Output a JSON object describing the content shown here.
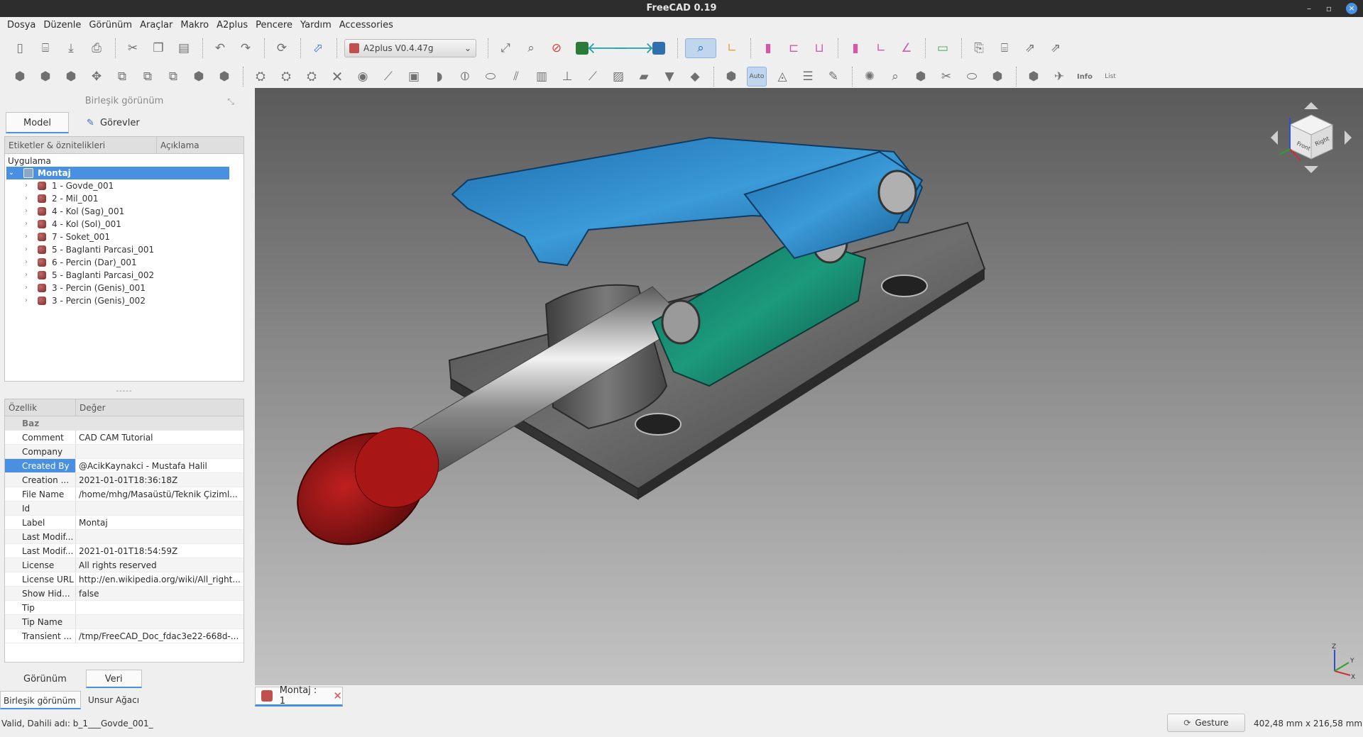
{
  "window": {
    "title": "FreeCAD 0.19"
  },
  "menu": [
    "Dosya",
    "Düzenle",
    "Görünüm",
    "Araçlar",
    "Makro",
    "A2plus",
    "Pencere",
    "Yardım",
    "Accessories"
  ],
  "toolbar": {
    "workbench": "A2plus V0.4.47g"
  },
  "combo_view": {
    "title": "Birleşik görünüm",
    "tabs": [
      "Model",
      "Görevler"
    ],
    "tree_headers": [
      "Etiketler & öznitelikleri",
      "Açıklama"
    ],
    "application": "Uygulama",
    "root": "Montaj",
    "items": [
      "1 - Govde_001",
      "2 - Mil_001",
      "4 - Kol (Sag)_001",
      "4 - Kol (Sol)_001",
      "7 - Soket_001",
      "5 - Baglanti Parcasi_001",
      "6 - Percin (Dar)_001",
      "5 - Baglanti Parcasi_002",
      "3 - Percin (Genis)_001",
      "3 - Percin (Genis)_002"
    ]
  },
  "properties": {
    "headers": [
      "Özellik",
      "Değer"
    ],
    "group": "Baz",
    "rows": [
      {
        "k": "Comment",
        "v": "CAD CAM Tutorial"
      },
      {
        "k": "Company",
        "v": ""
      },
      {
        "k": "Created By",
        "v": "@AcikKaynakci - Mustafa Halil"
      },
      {
        "k": "Creation ...",
        "v": "2021-01-01T18:36:18Z"
      },
      {
        "k": "File Name",
        "v": "/home/mhg/Masaüstü/Teknik Çiziml..."
      },
      {
        "k": "Id",
        "v": ""
      },
      {
        "k": "Label",
        "v": "Montaj"
      },
      {
        "k": "Last Modif...",
        "v": ""
      },
      {
        "k": "Last Modif...",
        "v": "2021-01-01T18:54:59Z"
      },
      {
        "k": "License",
        "v": "All rights reserved"
      },
      {
        "k": "License URL",
        "v": "http://en.wikipedia.org/wiki/All_right..."
      },
      {
        "k": "Show Hid...",
        "v": "false"
      },
      {
        "k": "Tip",
        "v": ""
      },
      {
        "k": "Tip Name",
        "v": ""
      },
      {
        "k": "Transient ...",
        "v": "/tmp/FreeCAD_Doc_fdac3e22-668d-..."
      }
    ]
  },
  "panel_tabs": [
    "Görünüm",
    "Veri"
  ],
  "dock_tabs": [
    "Birleşik görünüm",
    "Unsur Ağacı"
  ],
  "document_tab": "Montaj : 1",
  "status": {
    "message": "Valid, Dahili adı: b_1___Govde_001_",
    "nav_style": "Gesture",
    "dimensions": "402,48 mm x 216,58 mm"
  },
  "navcube": {
    "front": "Front",
    "right": "Right"
  },
  "axis": {
    "x": "X",
    "y": "Y",
    "z": "Z"
  }
}
